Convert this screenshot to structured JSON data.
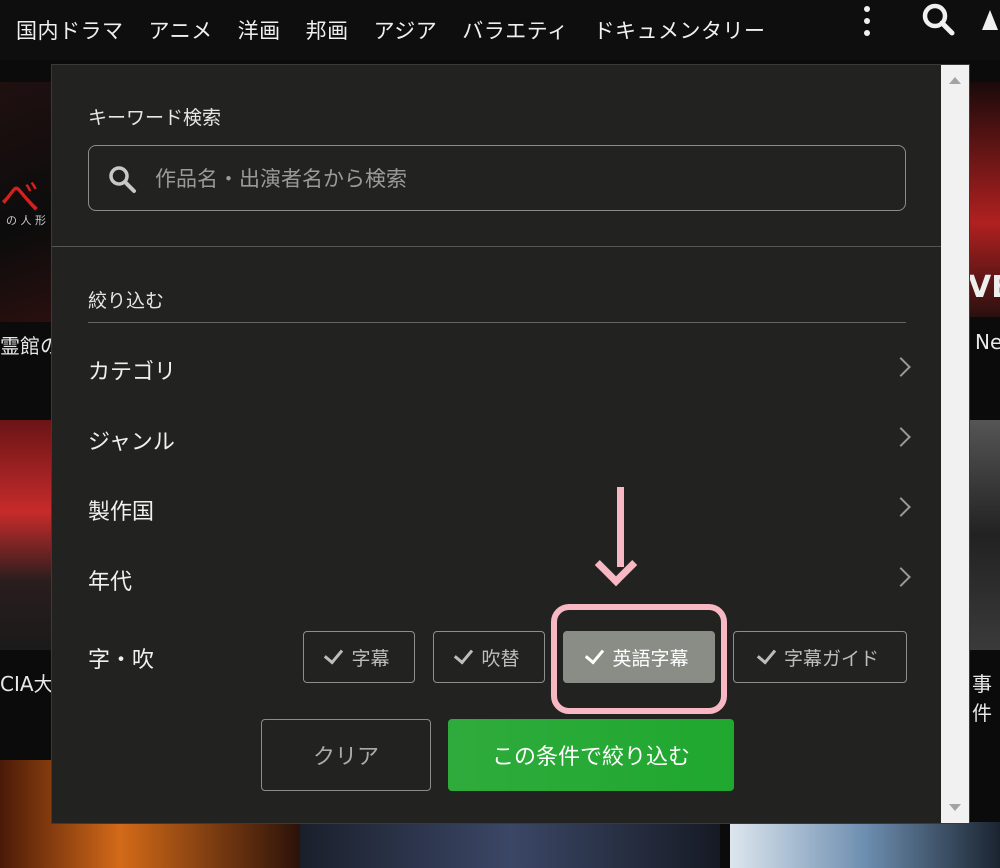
{
  "topnav": {
    "items": [
      "国内ドラマ",
      "アニメ",
      "洋画",
      "邦画",
      "アジア",
      "バラエティ",
      "ドキュメンタリー"
    ]
  },
  "background": {
    "left_poster_text": "べ",
    "left_poster_sub": "の 人 形",
    "left_caption_1": "霊館の",
    "left_caption_2": "CIA大",
    "right_poster_text": "VE",
    "right_caption_1": "Ne",
    "right_caption_2": "事件"
  },
  "search_panel": {
    "keyword_label": "キーワード検索",
    "keyword_placeholder": "作品名・出演者名から検索",
    "filter_label": "絞り込む",
    "rows": [
      {
        "label": "カテゴリ"
      },
      {
        "label": "ジャンル"
      },
      {
        "label": "製作国"
      },
      {
        "label": "年代"
      }
    ],
    "subtitle_label": "字・吹",
    "options": [
      {
        "label": "字幕",
        "selected": false
      },
      {
        "label": "吹替",
        "selected": false
      },
      {
        "label": "英語字幕",
        "selected": true
      },
      {
        "label": "字幕ガイド",
        "selected": false
      }
    ],
    "clear_label": "クリア",
    "apply_label": "この条件で絞り込む"
  },
  "colors": {
    "apply_button": "#2fab3c",
    "panel_bg": "#222320",
    "annotation": "#f7b8c4",
    "selected_option": "#8a8d86"
  }
}
